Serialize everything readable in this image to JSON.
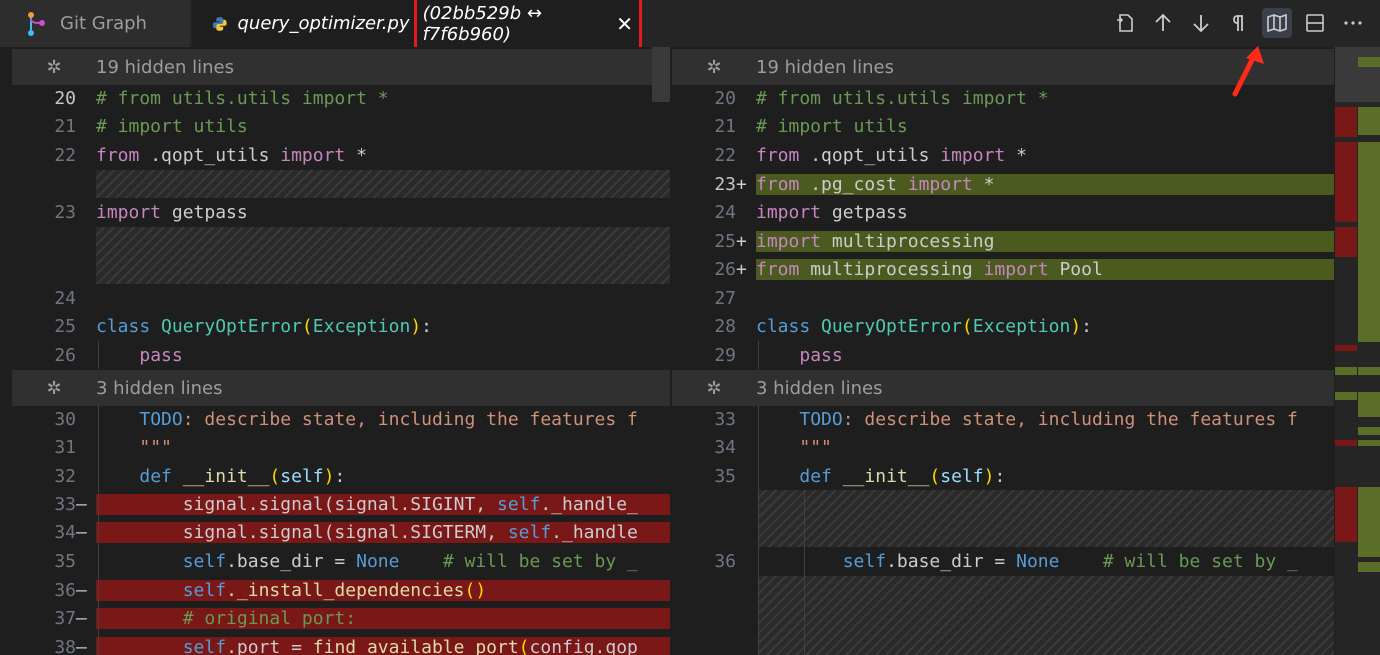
{
  "tabs": {
    "git_graph": "Git Graph",
    "file_name": "query_optimizer.py",
    "diff_range": "(02bb529b ↔ f7f6b960)",
    "close": "✕"
  },
  "toolbar": {
    "items": [
      "open-changes-icon",
      "previous-change-icon",
      "next-change-icon",
      "show-whitespace-icon",
      "minimap-icon",
      "split-editor-icon",
      "more-actions-icon"
    ],
    "active": "minimap-icon"
  },
  "left": {
    "hidden1": "19 hidden lines",
    "hidden2": "3 hidden lines",
    "ln": [
      "20",
      "21",
      "22",
      "23",
      "24",
      "25",
      "26",
      "30",
      "31",
      "32",
      "33",
      "34",
      "35",
      "36",
      "37",
      "38"
    ]
  },
  "right": {
    "hidden1": "19 hidden lines",
    "hidden2": "3 hidden lines",
    "ln": [
      "20",
      "21",
      "22",
      "23",
      "24",
      "25",
      "26",
      "27",
      "28",
      "29",
      "33",
      "34",
      "35",
      "36"
    ]
  },
  "code": {
    "from": "from",
    "import": "import",
    "class": "class",
    "def": "def",
    "comment_utils": "# from utils.utils import *",
    "comment_import": "# import utils",
    "qopt_mod": " .qopt_utils ",
    "star": " *",
    "getpass": " getpass",
    "cls_name": "QueryOptError",
    "exception": "Exception",
    "pass": "pass",
    "todo": "TODO",
    "todo_rest": ": describe state, including the features f",
    "triple_quote": "\"\"\"",
    "init": "__init__",
    "self": "self",
    "sig1_a": "signal.signal(signal.SIGINT, ",
    "sig1_b": "._handle_",
    "sig2_a": "signal.signal(signal.SIGTERM, ",
    "sig2_b": "._handle",
    "base_dir": ".base_dir = ",
    "none": "None",
    "comment_setby": "    # will be set by _",
    "install": "._install_dependencies",
    "comment_orig": "# original port:",
    "port_a": ".port = ",
    "find_port": "find_available_port",
    "port_b": "config.qop",
    "pg_cost": " .pg_cost ",
    "multiprocessing": " multiprocessing",
    "multiprocessing2": " multiprocessing ",
    "pool": " Pool",
    "colon": ":",
    "lparen": "(",
    "rparen": ")",
    "space": " "
  },
  "colors": {
    "deleted": "#7a1717",
    "inserted": "#4b5b1f",
    "highlight_box": "#e51a1a"
  }
}
